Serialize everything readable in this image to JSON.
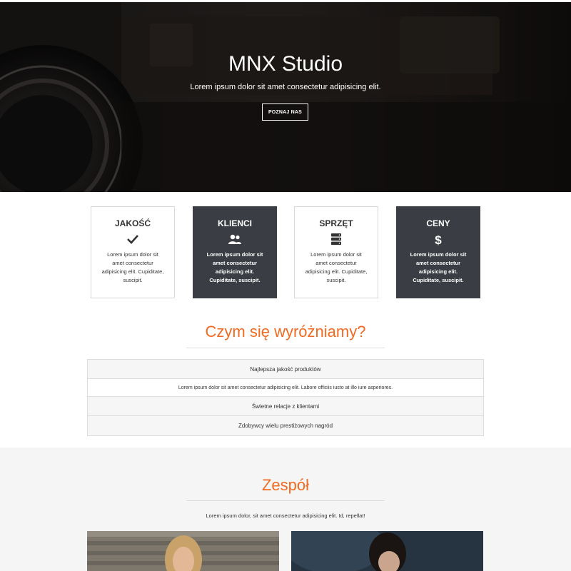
{
  "hero": {
    "title": "MNX Studio",
    "subtitle": "Lorem ipsum dolor sit amet consectetur adipisicing elit.",
    "button_label": "POZNAJ NAS"
  },
  "features": [
    {
      "title": "JAKOŚĆ",
      "icon": "check-icon",
      "text": "Lorem ipsum dolor sit amet consectetur adipisicing elit. Cupiditate, suscipit.",
      "dark": false
    },
    {
      "title": "KLIENCI",
      "icon": "users-icon",
      "text": "Lorem ipsum dolor sit amet consectetur adipisicing elit. Cupiditate, suscipit.",
      "dark": true
    },
    {
      "title": "SPRZĘT",
      "icon": "server-icon",
      "text": "Lorem ipsum dolor sit amet consectetur adipisicing elit. Cupiditate, suscipit.",
      "dark": false
    },
    {
      "title": "CENY",
      "icon": "dollar-icon",
      "text": "Lorem ipsum dolor sit amet consectetur adipisicing elit. Cupiditate, suscipit.",
      "dark": true
    }
  ],
  "why": {
    "heading": "Czym się wyróżniamy?",
    "items": [
      {
        "label": "Najlepsza jakość produktów",
        "body": "Lorem ipsum dolor sit amet consectetur adipisicing elit. Labore officiis iusto at illo iure asperiores."
      },
      {
        "label": "Świetne relacje z klientami"
      },
      {
        "label": "Zdobywcy wielu prestiżowych nagród"
      }
    ]
  },
  "team": {
    "heading": "Zespół",
    "intro": "Lorem ipsum dolor, sit amet consectetur adipisicing elit. Id, repellat!"
  },
  "colors": {
    "accent": "#f16a22",
    "dark_box": "#3a3d43",
    "team_bg": "#f5f5f5"
  }
}
